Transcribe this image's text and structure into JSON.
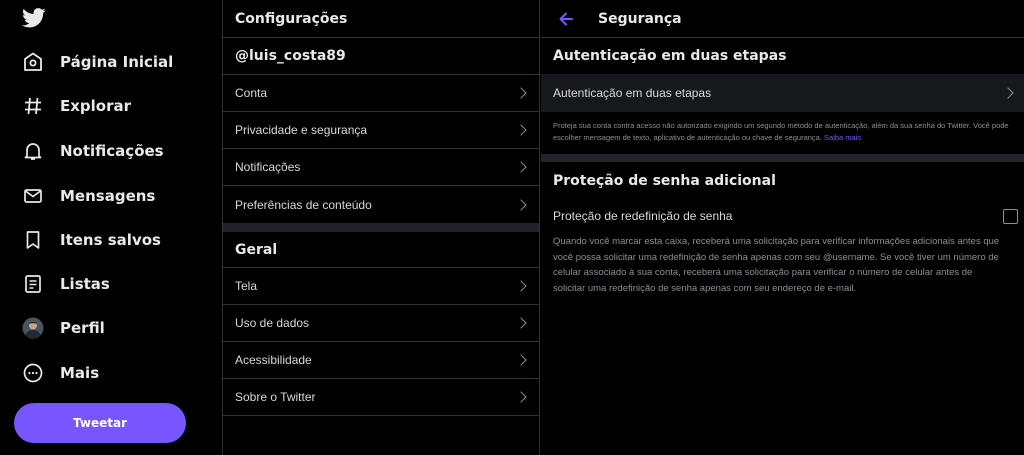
{
  "colors": {
    "accent": "#7856ff",
    "background": "#000000",
    "divider": "#2f3336",
    "muted": "#8b8f94"
  },
  "nav": {
    "logo_icon": "twitter-bird-icon",
    "items": [
      {
        "label": "Página Inicial",
        "icon": "home-icon"
      },
      {
        "label": "Explorar",
        "icon": "hashtag-icon"
      },
      {
        "label": "Notificações",
        "icon": "bell-icon"
      },
      {
        "label": "Mensagens",
        "icon": "envelope-icon"
      },
      {
        "label": "Itens salvos",
        "icon": "bookmark-icon"
      },
      {
        "label": "Listas",
        "icon": "list-icon"
      },
      {
        "label": "Perfil",
        "icon": "avatar"
      },
      {
        "label": "Mais",
        "icon": "more-circle-icon"
      }
    ],
    "tweet_label": "Tweetar"
  },
  "settings": {
    "title": "Configurações",
    "username": "@luis_costa89",
    "account_items": [
      {
        "label": "Conta"
      },
      {
        "label": "Privacidade e segurança"
      },
      {
        "label": "Notificações"
      },
      {
        "label": "Preferências de conteúdo"
      }
    ],
    "general_title": "Geral",
    "general_items": [
      {
        "label": "Tela"
      },
      {
        "label": "Uso de dados"
      },
      {
        "label": "Acessibilidade"
      },
      {
        "label": "Sobre o Twitter"
      }
    ]
  },
  "security": {
    "title": "Segurança",
    "two_factor_title": "Autenticação em duas etapas",
    "two_factor_row": "Autenticação em duas etapas",
    "two_factor_desc": "Proteja sua conta contra acesso não autorizado exigindo um segundo método de autenticação, além da sua senha do Twitter. Você pode escolher mensagem de texto, aplicativo de autenticação ou chave de segurança.",
    "learn_more": "Saiba mais",
    "password_title": "Proteção de senha adicional",
    "reset_protection_label": "Proteção de redefinição de senha",
    "reset_protection_checked": false,
    "reset_protection_desc": "Quando você marcar esta caixa, receberá uma solicitação para verificar informações adicionais antes que você possa solicitar uma redefinição de senha apenas com seu @username. Se você tiver um número de celular associado à sua conta, receberá uma solicitação para verificar o número de celular antes de solicitar uma redefinição de senha apenas com seu endereço de e-mail."
  }
}
